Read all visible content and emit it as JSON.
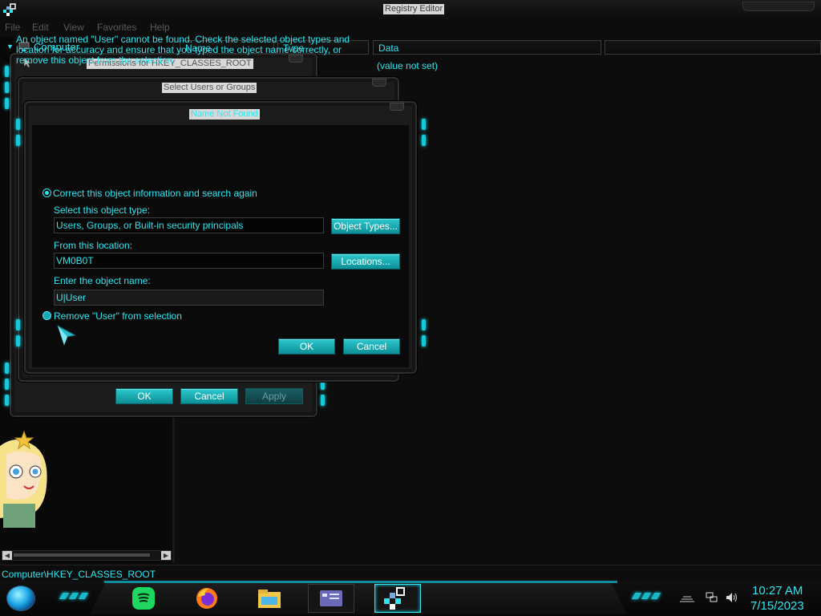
{
  "app": {
    "title": "Registry Editor",
    "menu": [
      "File",
      "Edit",
      "View",
      "Favorites",
      "Help"
    ]
  },
  "tree": {
    "root_label": "Computer"
  },
  "list": {
    "columns": [
      "Name",
      "Type",
      "Data"
    ],
    "value_data": "(value not set)"
  },
  "status_bar": {
    "path": "Computer\\HKEY_CLASSES_ROOT"
  },
  "dialogs": {
    "permissions": {
      "title": "Permissions for HKEY_CLASSES_ROOT",
      "ok_label": "OK",
      "cancel_label": "Cancel",
      "apply_label": "Apply"
    },
    "select_users": {
      "title": "Select Users or Groups"
    },
    "name_not_found": {
      "title": "Name Not Found",
      "message": "An object named \"User\" cannot be found. Check the selected object types and location for accuracy and ensure that you typed the object name correctly, or remove this object from the selection.",
      "option_correct": "Correct this object information and search again",
      "object_type_label": "Select this object type:",
      "object_type_value": "Users, Groups, or Built-in security principals",
      "object_types_button": "Object Types...",
      "location_label": "From this location:",
      "location_value": "VM0B0T",
      "locations_button": "Locations...",
      "object_name_label": "Enter the object name:",
      "object_name_value": "U|User",
      "option_remove": "Remove \"User\" from selection",
      "ok_label": "OK",
      "cancel_label": "Cancel"
    }
  },
  "taskbar": {
    "clock_time": "10:27 AM",
    "clock_date": "7/15/2023",
    "apps": [
      "spotify-icon",
      "firefox-icon",
      "file-explorer-icon",
      "control-panel-icon",
      "registry-editor-icon"
    ]
  },
  "colors": {
    "accent": "#2ee6f0",
    "button": "#17b4bb",
    "background": "#0b0b0b"
  }
}
